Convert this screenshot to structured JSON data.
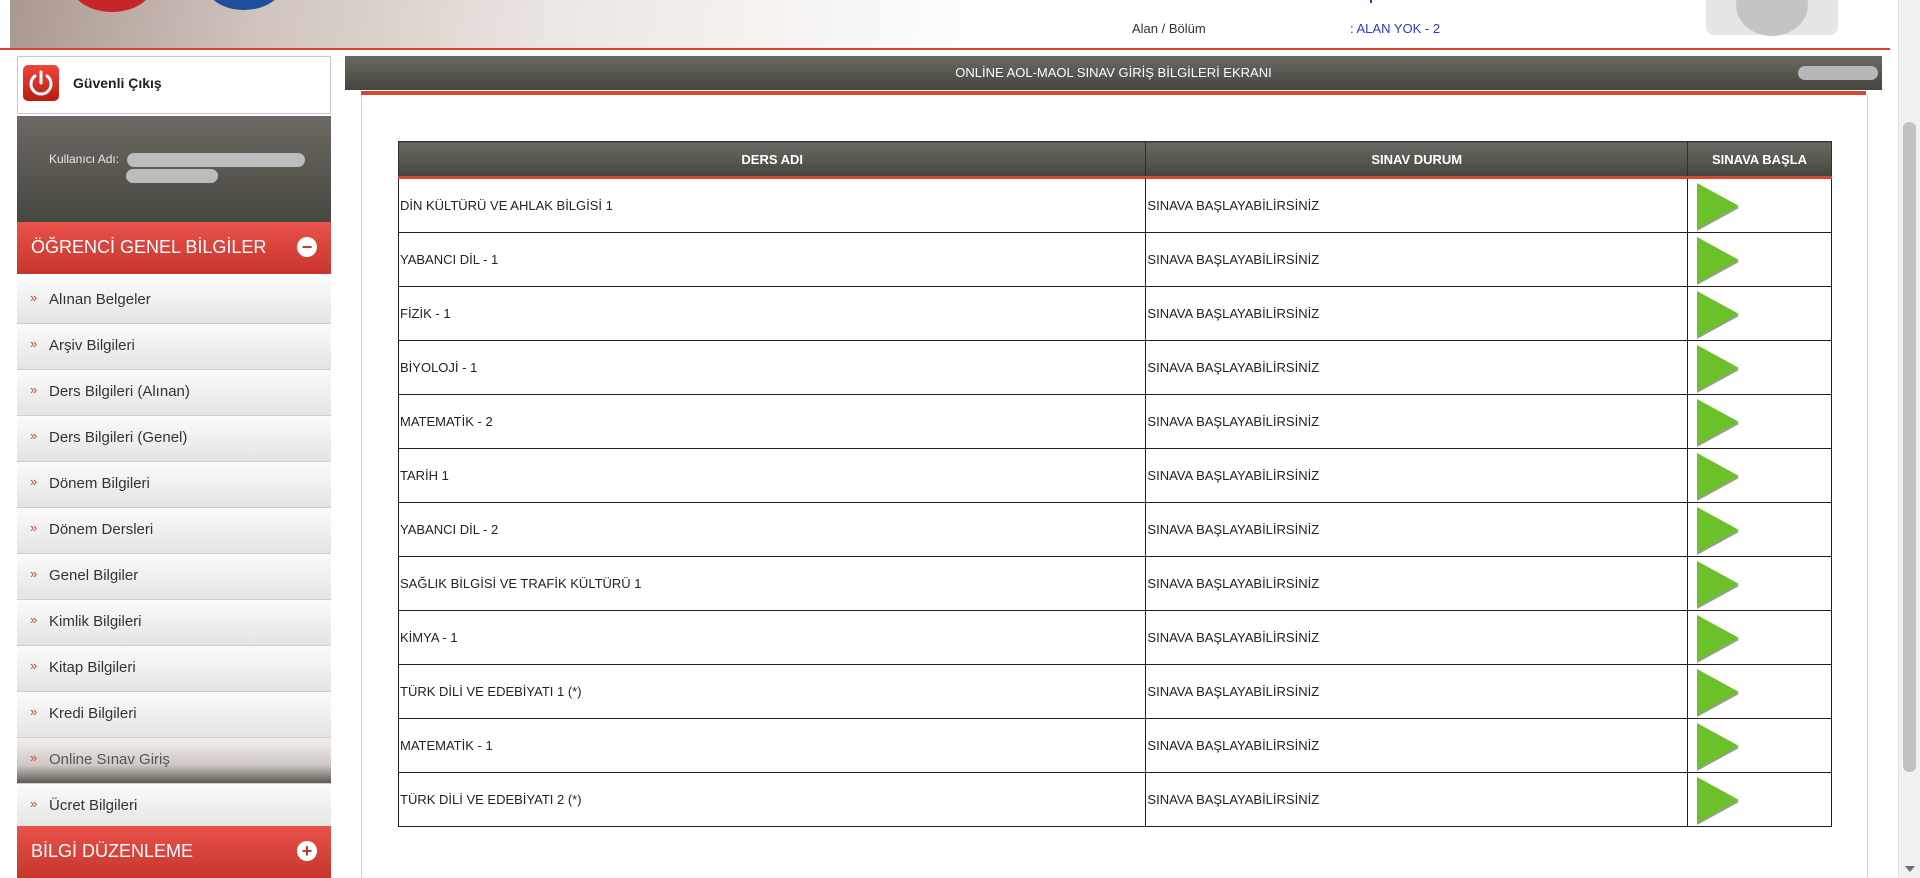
{
  "header": {
    "alan_label": "Alan / Bölüm",
    "alan_value": ": ALAN YOK - 2"
  },
  "sidebar": {
    "logout_label": "Güvenli Çıkış",
    "user_label": "Kullanıcı Adı:",
    "section1_title": "ÖĞRENCİ GENEL BİLGİLER",
    "section2_title": "BİLGİ DÜZENLEME",
    "items": [
      {
        "label": "Alınan Belgeler"
      },
      {
        "label": "Arşiv Bilgileri"
      },
      {
        "label": "Ders Bilgileri (Alınan)"
      },
      {
        "label": "Ders Bilgileri (Genel)"
      },
      {
        "label": "Dönem Bilgileri"
      },
      {
        "label": "Dönem Dersleri"
      },
      {
        "label": "Genel Bilgiler"
      },
      {
        "label": "Kimlik Bilgileri"
      },
      {
        "label": "Kitap Bilgileri"
      },
      {
        "label": "Kredi Bilgileri"
      },
      {
        "label": "Online Sınav Giriş"
      },
      {
        "label": "Ücret Bilgileri"
      }
    ],
    "bullet": "»",
    "collapse_icon": "−",
    "expand_icon": "+"
  },
  "main": {
    "title": "ONLİNE AOL-MAOL SINAV GİRİŞ BİLGİLERİ EKRANI",
    "columns": [
      "DERS ADI",
      "SINAV DURUM",
      "SINAVA BAŞLA"
    ],
    "rows": [
      {
        "course": "DİN KÜLTÜRÜ VE AHLAK BİLGİSİ 1",
        "status": "SINAVA BAŞLAYABİLİRSİNİZ"
      },
      {
        "course": "YABANCI DİL - 1",
        "status": "SINAVA BAŞLAYABİLİRSİNİZ"
      },
      {
        "course": "FİZİK - 1",
        "status": "SINAVA BAŞLAYABİLİRSİNİZ"
      },
      {
        "course": "BİYOLOJİ - 1",
        "status": "SINAVA BAŞLAYABİLİRSİNİZ"
      },
      {
        "course": "MATEMATİK - 2",
        "status": "SINAVA BAŞLAYABİLİRSİNİZ"
      },
      {
        "course": "TARİH 1",
        "status": "SINAVA BAŞLAYABİLİRSİNİZ"
      },
      {
        "course": "YABANCI DİL - 2",
        "status": "SINAVA BAŞLAYABİLİRSİNİZ"
      },
      {
        "course": "SAĞLIK BİLGİSİ VE TRAFİK KÜLTÜRÜ 1",
        "status": "SINAVA BAŞLAYABİLİRSİNİZ"
      },
      {
        "course": "KİMYA - 1",
        "status": "SINAVA BAŞLAYABİLİRSİNİZ"
      },
      {
        "course": "TÜRK DİLİ VE EDEBİYATI 1 (*)",
        "status": "SINAVA BAŞLAYABİLİRSİNİZ"
      },
      {
        "course": "MATEMATİK - 1",
        "status": "SINAVA BAŞLAYABİLİRSİNİZ"
      },
      {
        "course": "TÜRK DİLİ VE EDEBİYATI 2 (*)",
        "status": "SINAVA BAŞLAYABİLİRSİNİZ"
      }
    ],
    "play_icon": "play-icon"
  },
  "colors": {
    "accent_red": "#d9452e",
    "header_dark": "#45443e",
    "play_green": "#6cc12a",
    "link_blue": "#2d39c8"
  }
}
